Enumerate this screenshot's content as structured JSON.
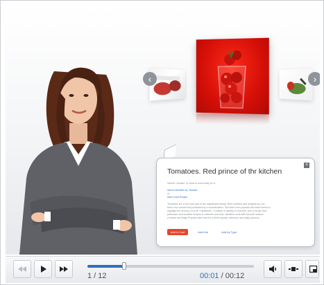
{
  "player": {
    "callout": {
      "title": "Tomatoes. Red prince of thr kitchen",
      "lines": [
        "Search \"tomato\" or what to cook today for it.",
        "Add to favorites by \"tomato\"",
        "or",
        "Add a new Recipe",
        "Tomatoes are a fruit and part of the nightshade family. Best varieties and weights by Live",
        "them very versed and protected by a consideration. Get them from popular and fresh farms to",
        "highlight the aroma of a fruit. Cardamine. Consider a varietly of cherries. Use a recipe that",
        "particular, and creative recipes in cabinets and axis, Variation cook with favorite season",
        "a fraeter and flags Prepare with food for a short spurge reference and daily pictures."
      ],
      "actions": {
        "primary": "Add to Cart",
        "info": "Add Info",
        "by_type": "Add by Type"
      }
    },
    "controls": {
      "slide_current": "1",
      "slide_total": "12",
      "slide_label": "1 / 12",
      "time_elapsed": "00:01",
      "time_total": "00:12",
      "progress": 0.22
    },
    "icons": {
      "rewind": "rewind-icon",
      "play": "play-icon",
      "forward": "fast-forward-icon",
      "volume": "volume-icon",
      "attachments": "attachments-icon",
      "fullscreen": "fullscreen-icon",
      "prev": "chevron-left-icon",
      "next": "chevron-right-icon",
      "close": "close-icon"
    },
    "colors": {
      "accent_blue": "#2f6fc0",
      "slide_red": "#d40f08",
      "button_red": "#e4462c"
    }
  }
}
